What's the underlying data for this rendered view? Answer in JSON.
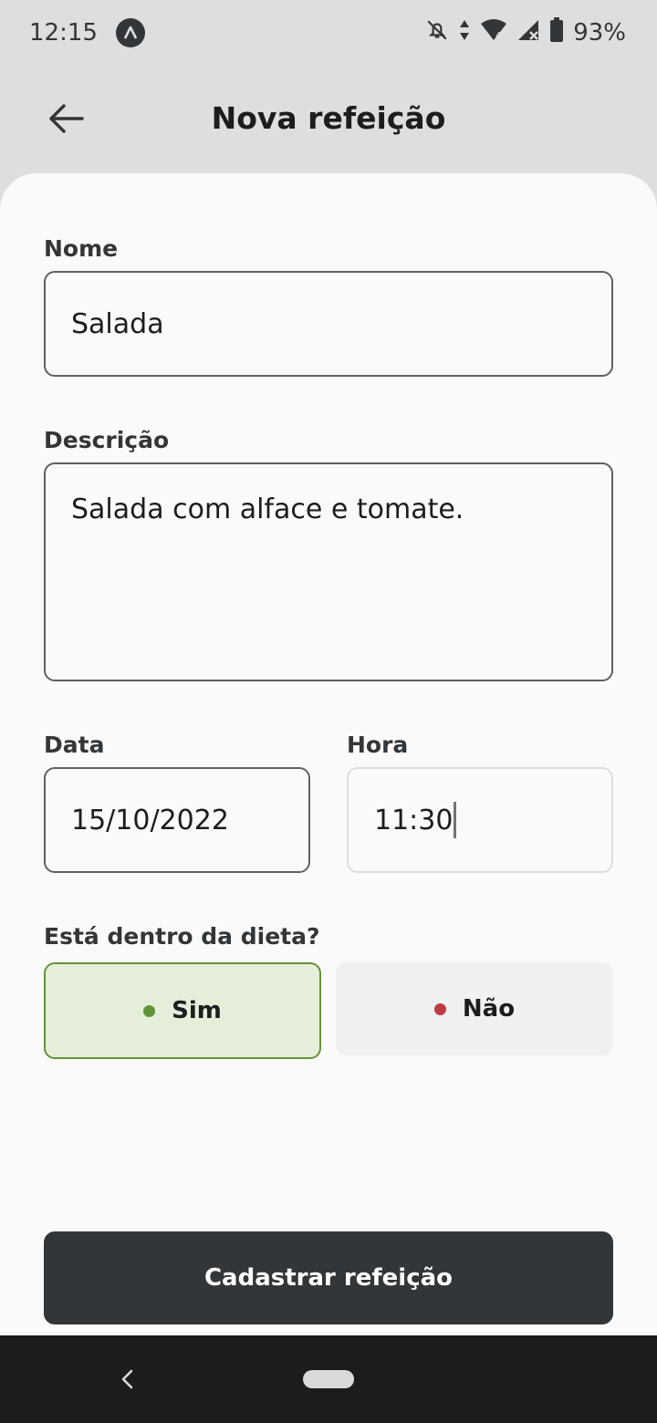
{
  "status_bar": {
    "time": "12:15",
    "battery": "93%",
    "icons": [
      "app-icon",
      "notifications-off-icon",
      "data-transfer-icon",
      "wifi-icon",
      "cell-signal-icon",
      "battery-icon"
    ]
  },
  "header": {
    "title": "Nova refeição",
    "back_icon": "arrow-left-icon"
  },
  "form": {
    "name": {
      "label": "Nome",
      "value": "Salada"
    },
    "description": {
      "label": "Descrição",
      "value": "Salada com alface e tomate."
    },
    "date": {
      "label": "Data",
      "value": "15/10/2022"
    },
    "time": {
      "label": "Hora",
      "value": "11:30"
    },
    "diet": {
      "label": "Está dentro da dieta?",
      "options": [
        {
          "label": "Sim",
          "selected": true,
          "dot_color": "#639339"
        },
        {
          "label": "Não",
          "selected": false,
          "dot_color": "#bf3b44"
        }
      ]
    },
    "submit_label": "Cadastrar refeição"
  },
  "colors": {
    "header_bg": "#dddee0",
    "sheet_bg": "#fafafa",
    "button_bg": "#333638",
    "green_light": "#e4eed9",
    "green_dark": "#639339",
    "red_dark": "#bf3b44"
  }
}
